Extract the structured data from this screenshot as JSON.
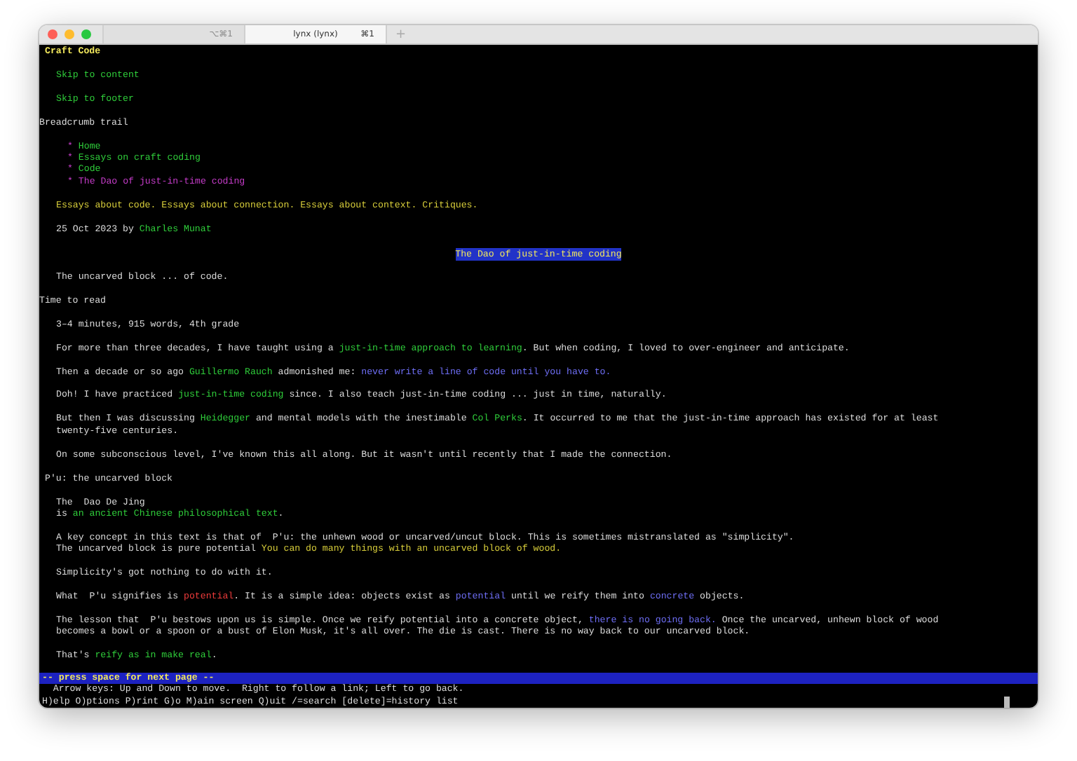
{
  "window": {
    "tabs": [
      {
        "shortcut": "⌥⌘1",
        "selected": false
      },
      {
        "label": "lynx (lynx)",
        "shortcut": "⌘1",
        "selected": true
      }
    ],
    "new_tab": "+"
  },
  "page": [
    {
      "kind": "banner",
      "lines": [
        [
          {
            "text": "Craft Code",
            "kind": "plain"
          }
        ]
      ]
    },
    {
      "kind": "body",
      "lines": [
        [
          {
            "text": "Skip to content",
            "kind": "link"
          }
        ]
      ]
    },
    {
      "kind": "body",
      "lines": [
        [
          {
            "text": "Skip to footer",
            "kind": "link"
          }
        ]
      ]
    },
    {
      "kind": "heading",
      "lines": [
        [
          {
            "text": "Breadcrumb trail",
            "kind": "plain"
          }
        ]
      ]
    },
    {
      "kind": "list",
      "lines": [
        [
          {
            "text": "* ",
            "kind": "current"
          },
          {
            "text": "Home",
            "kind": "link"
          }
        ],
        [
          {
            "text": "* ",
            "kind": "current"
          },
          {
            "text": "Essays on craft coding",
            "kind": "link"
          }
        ],
        [
          {
            "text": "* ",
            "kind": "current"
          },
          {
            "text": "Code",
            "kind": "link"
          }
        ],
        [
          {
            "text": "* The Dao of just-in-time coding",
            "kind": "current"
          }
        ]
      ]
    },
    {
      "kind": "body",
      "lines": [
        [
          {
            "text": "Essays about code. Essays about connection. Essays about context. Critiques.",
            "kind": "tagline"
          }
        ]
      ]
    },
    {
      "kind": "body",
      "lines": [
        [
          {
            "text": "25 Oct 2023 by ",
            "kind": "plain"
          },
          {
            "text": "Charles Munat",
            "kind": "link"
          }
        ]
      ]
    },
    {
      "kind": "center",
      "lines": [
        [
          {
            "text": "The Dao of just-in-time coding",
            "kind": "title"
          }
        ]
      ]
    },
    {
      "kind": "body",
      "lines": [
        [
          {
            "text": "The uncarved block ... of code.",
            "kind": "plain"
          }
        ]
      ]
    },
    {
      "kind": "heading",
      "lines": [
        [
          {
            "text": "Time to read",
            "kind": "plain"
          }
        ]
      ]
    },
    {
      "kind": "body",
      "lines": [
        [
          {
            "text": "3–4 minutes, 915 words, 4th grade",
            "kind": "plain"
          }
        ]
      ]
    },
    {
      "kind": "body",
      "lines": [
        [
          {
            "text": "For more than three decades, I have taught using a ",
            "kind": "plain"
          },
          {
            "text": "just-in-time approach to learning",
            "kind": "link"
          },
          {
            "text": ". But when coding, I loved to over-engineer and anticipate.",
            "kind": "plain"
          }
        ]
      ]
    },
    {
      "kind": "body",
      "lines": [
        [
          {
            "text": "Then a decade or so ago ",
            "kind": "plain"
          },
          {
            "text": "Guillermo Rauch",
            "kind": "link"
          },
          {
            "text": " admonished me: ",
            "kind": "plain"
          },
          {
            "text": "never write a line of code until you have to.",
            "kind": "soft"
          }
        ]
      ]
    },
    {
      "kind": "body",
      "lines": [
        [
          {
            "text": "Doh! I have practiced ",
            "kind": "plain"
          },
          {
            "text": "just-in-time coding",
            "kind": "link"
          },
          {
            "text": " since. I also teach just-in-time coding ... just in time, naturally.",
            "kind": "plain"
          }
        ]
      ]
    },
    {
      "kind": "body",
      "lines": [
        [
          {
            "text": "But then I was discussing ",
            "kind": "plain"
          },
          {
            "text": "Heidegger",
            "kind": "link"
          },
          {
            "text": " and mental models with the inestimable ",
            "kind": "plain"
          },
          {
            "text": "Col Perks",
            "kind": "link"
          },
          {
            "text": ". It occurred to me that the just-in-time approach has existed for at least",
            "kind": "plain"
          }
        ],
        [
          {
            "text": "twenty-five centuries.",
            "kind": "plain"
          }
        ]
      ]
    },
    {
      "kind": "body",
      "lines": [
        [
          {
            "text": "On some subconscious level, I've known this all along. But it wasn't until recently that I made the connection.",
            "kind": "plain"
          }
        ]
      ]
    },
    {
      "kind": "subheading",
      "lines": [
        [
          {
            "text": "P'u: the uncarved block",
            "kind": "plain"
          }
        ]
      ]
    },
    {
      "kind": "body",
      "lines": [
        [
          {
            "text": "The  Dao De Jing",
            "kind": "plain"
          }
        ],
        [
          {
            "text": "is ",
            "kind": "plain"
          },
          {
            "text": "an ancient Chinese philosophical text",
            "kind": "link"
          },
          {
            "text": ".",
            "kind": "plain"
          }
        ]
      ]
    },
    {
      "kind": "body",
      "lines": [
        [
          {
            "text": "A key concept in this text is that of  P'u: the unhewn wood or uncarved/uncut block. This is sometimes mistranslated as \"simplicity\".",
            "kind": "plain"
          }
        ],
        [
          {
            "text": "The uncarved block is pure potential ",
            "kind": "plain"
          },
          {
            "text": "You can do many things with an uncarved block of wood.",
            "kind": "tagline"
          }
        ]
      ]
    },
    {
      "kind": "body",
      "lines": [
        [
          {
            "text": "Simplicity's got nothing to do with it.",
            "kind": "plain"
          }
        ]
      ]
    },
    {
      "kind": "body",
      "lines": [
        [
          {
            "text": "What  P'u signifies is ",
            "kind": "plain"
          },
          {
            "text": "potential",
            "kind": "alert"
          },
          {
            "text": ". It is a simple idea: objects exist as ",
            "kind": "plain"
          },
          {
            "text": "potential",
            "kind": "soft"
          },
          {
            "text": " until we reify them into ",
            "kind": "plain"
          },
          {
            "text": "concrete",
            "kind": "soft"
          },
          {
            "text": " objects.",
            "kind": "plain"
          }
        ]
      ]
    },
    {
      "kind": "body",
      "lines": [
        [
          {
            "text": "The lesson that  P'u bestows upon us is simple. Once we reify potential into a concrete object, ",
            "kind": "plain"
          },
          {
            "text": "there is no going back.",
            "kind": "soft"
          },
          {
            "text": " Once the uncarved, unhewn block of wood",
            "kind": "plain"
          }
        ],
        [
          {
            "text": "becomes a bowl or a spoon or a bust of Elon Musk, it's all over. The die is cast. There is no way back to our uncarved block.",
            "kind": "plain"
          }
        ]
      ]
    },
    {
      "kind": "body",
      "lines": [
        [
          {
            "text": "That's ",
            "kind": "plain"
          },
          {
            "text": "reify as in make real",
            "kind": "link"
          },
          {
            "text": ".",
            "kind": "plain"
          }
        ]
      ]
    }
  ],
  "status_bar": "-- press space for next page --",
  "help": [
    "  Arrow keys: Up and Down to move.  Right to follow a link; Left to go back.",
    "H)elp O)ptions P)rint G)o M)ain screen Q)uit /=search [delete]=history list"
  ]
}
